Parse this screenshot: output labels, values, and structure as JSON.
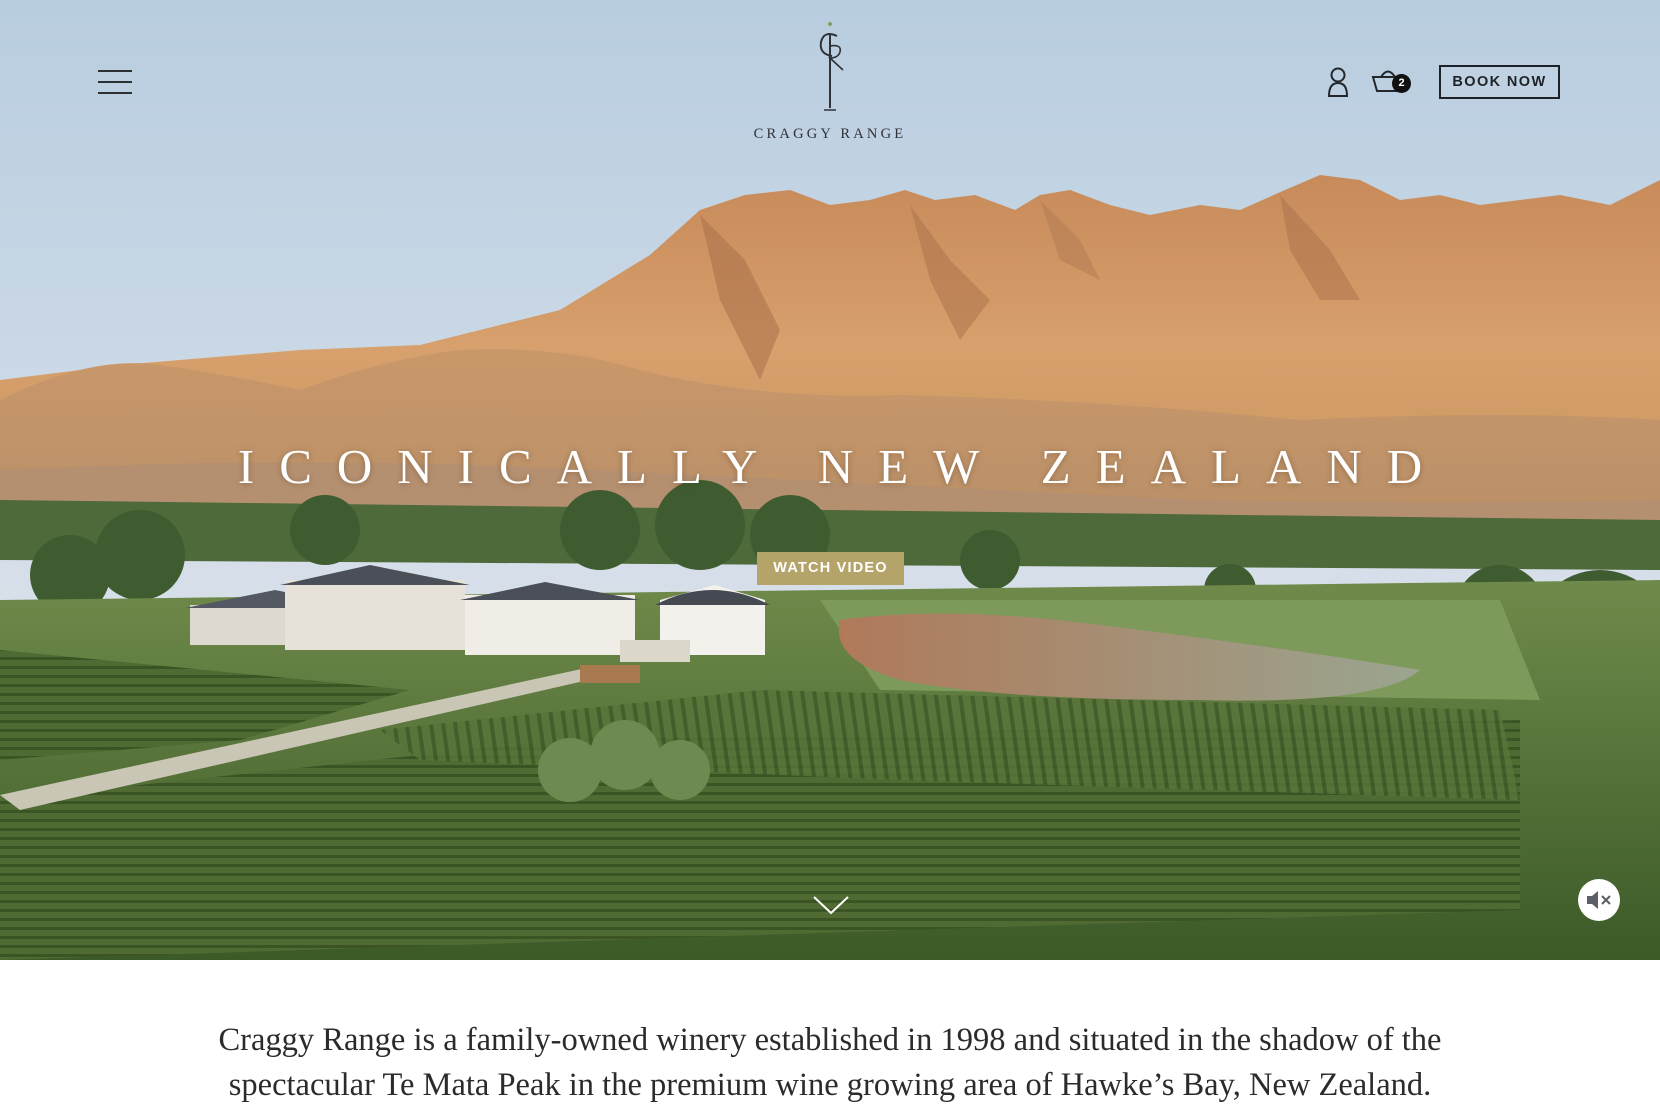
{
  "header": {
    "menu_icon": "hamburger-menu-icon",
    "logo_monogram": "CR",
    "logo_text": "CRAGGY RANGE",
    "account_icon": "user-icon",
    "cart_icon": "basket-icon",
    "cart_count": "2",
    "book_now_label": "BOOK NOW"
  },
  "hero": {
    "title": "ICONICALLY NEW ZEALAND",
    "watch_video_label": "WATCH VIDEO",
    "scroll_icon": "chevron-down-icon",
    "mute_icon": "speaker-muted-icon"
  },
  "intro": {
    "text": "Craggy Range is a family-owned winery established in 1998 and situated in the shadow of the spectacular Te Mata Peak in the premium wine growing area of Hawke’s Bay, New Zealand."
  },
  "colors": {
    "accent_gold": "#b5a46a",
    "dark_text": "#1e2226"
  }
}
